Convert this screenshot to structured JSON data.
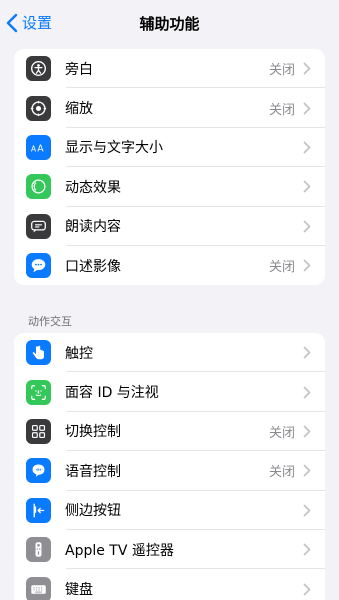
{
  "nav": {
    "back_label": "设置",
    "title": "辅助功能"
  },
  "vision": {
    "items": [
      {
        "label": "旁白",
        "value": "关闭",
        "icon": "voiceover-icon",
        "color": "#3a3a3c"
      },
      {
        "label": "缩放",
        "value": "关闭",
        "icon": "zoom-icon",
        "color": "#3a3a3c"
      },
      {
        "label": "显示与文字大小",
        "value": "",
        "icon": "text-size-icon",
        "color": "#0a7aff"
      },
      {
        "label": "动态效果",
        "value": "",
        "icon": "motion-icon",
        "color": "#34c759"
      },
      {
        "label": "朗读内容",
        "value": "",
        "icon": "spoken-content-icon",
        "color": "#3a3a3c"
      },
      {
        "label": "口述影像",
        "value": "关闭",
        "icon": "audio-description-icon",
        "color": "#0a7aff"
      }
    ]
  },
  "interaction": {
    "header": "动作交互",
    "items": [
      {
        "label": "触控",
        "value": "",
        "icon": "touch-icon",
        "color": "#0a7aff"
      },
      {
        "label": "面容 ID 与注视",
        "value": "",
        "icon": "face-id-icon",
        "color": "#34c759"
      },
      {
        "label": "切换控制",
        "value": "关闭",
        "icon": "switch-control-icon",
        "color": "#3a3a3c"
      },
      {
        "label": "语音控制",
        "value": "关闭",
        "icon": "voice-control-icon",
        "color": "#0a7aff"
      },
      {
        "label": "侧边按钮",
        "value": "",
        "icon": "side-button-icon",
        "color": "#0a7aff"
      },
      {
        "label": "Apple TV 遥控器",
        "value": "",
        "icon": "tv-remote-icon",
        "color": "#8e8e93"
      },
      {
        "label": "键盘",
        "value": "",
        "icon": "keyboard-icon",
        "color": "#8e8e93"
      }
    ]
  }
}
